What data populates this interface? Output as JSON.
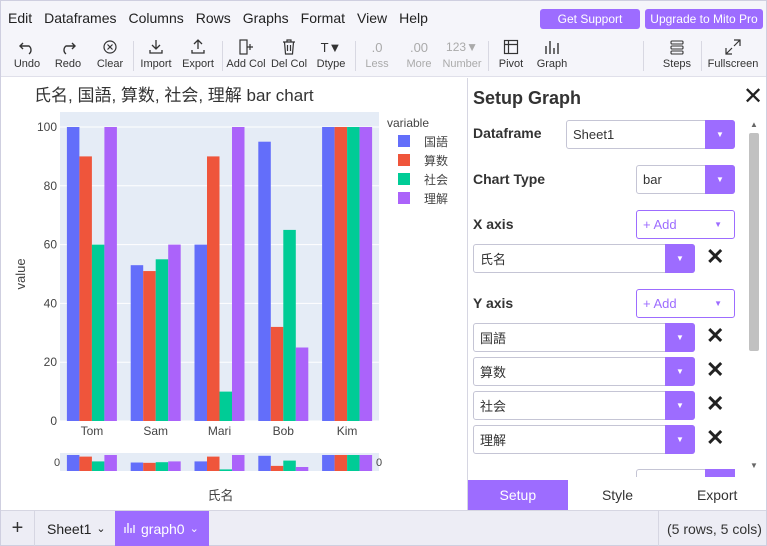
{
  "menu": {
    "items": [
      "Edit",
      "Dataframes",
      "Columns",
      "Rows",
      "Graphs",
      "Format",
      "View",
      "Help"
    ],
    "get_support": "Get Support",
    "upgrade": "Upgrade to Mito Pro"
  },
  "toolbar": {
    "undo": "Undo",
    "redo": "Redo",
    "clear": "Clear",
    "import": "Import",
    "export": "Export",
    "add_col": "Add Col",
    "del_col": "Del Col",
    "dtype": "Dtype",
    "less": "Less",
    "more": "More",
    "number": "Number",
    "pivot": "Pivot",
    "graph": "Graph",
    "steps": "Steps",
    "fullscreen": "Fullscreen",
    "dtype_glyph": "T▼",
    "less_glyph": ".0",
    "more_glyph": ".00",
    "number_glyph": "123▼"
  },
  "chart_data": {
    "type": "bar",
    "title": "氏名, 国語, 算数, 社会, 理解 bar chart",
    "xlabel": "氏名",
    "ylabel": "value",
    "categories": [
      "Tom",
      "Sam",
      "Mari",
      "Bob",
      "Kim"
    ],
    "legend_title": "variable",
    "legend_position": "top-right",
    "series": [
      {
        "name": "国語",
        "color": "#636efa",
        "values": [
          100,
          53,
          60,
          95,
          100
        ]
      },
      {
        "name": "算数",
        "color": "#ef553b",
        "values": [
          90,
          51,
          90,
          32,
          100
        ]
      },
      {
        "name": "社会",
        "color": "#00cc96",
        "values": [
          60,
          55,
          10,
          65,
          100
        ]
      },
      {
        "name": "理解",
        "color": "#ab63fa",
        "values": [
          100,
          60,
          100,
          25,
          100
        ]
      }
    ],
    "ylim": [
      0,
      100
    ],
    "yticks": [
      "0",
      "20",
      "40",
      "60",
      "80",
      "100"
    ],
    "grid": true,
    "rangeslider_labels": [
      "0",
      "0"
    ]
  },
  "panel": {
    "title": "Setup Graph",
    "dataframe_label": "Dataframe",
    "dataframe_value": "Sheet1",
    "chart_type_label": "Chart Type",
    "chart_type_value": "bar",
    "x_axis_label": "X axis",
    "x_add": "+ Add",
    "x_value": "氏名",
    "y_axis_label": "Y axis",
    "y_add": "+ Add",
    "y_values": [
      "国語",
      "算数",
      "社会",
      "理解"
    ],
    "tabs": [
      "Setup",
      "Style",
      "Export"
    ]
  },
  "bottom": {
    "sheet": "Sheet1",
    "graph": "graph0",
    "rows_cols": "(5 rows, 5 cols)"
  },
  "colors": {
    "accent": "#9d6cff",
    "plot_bg": "#e5ecf6"
  }
}
